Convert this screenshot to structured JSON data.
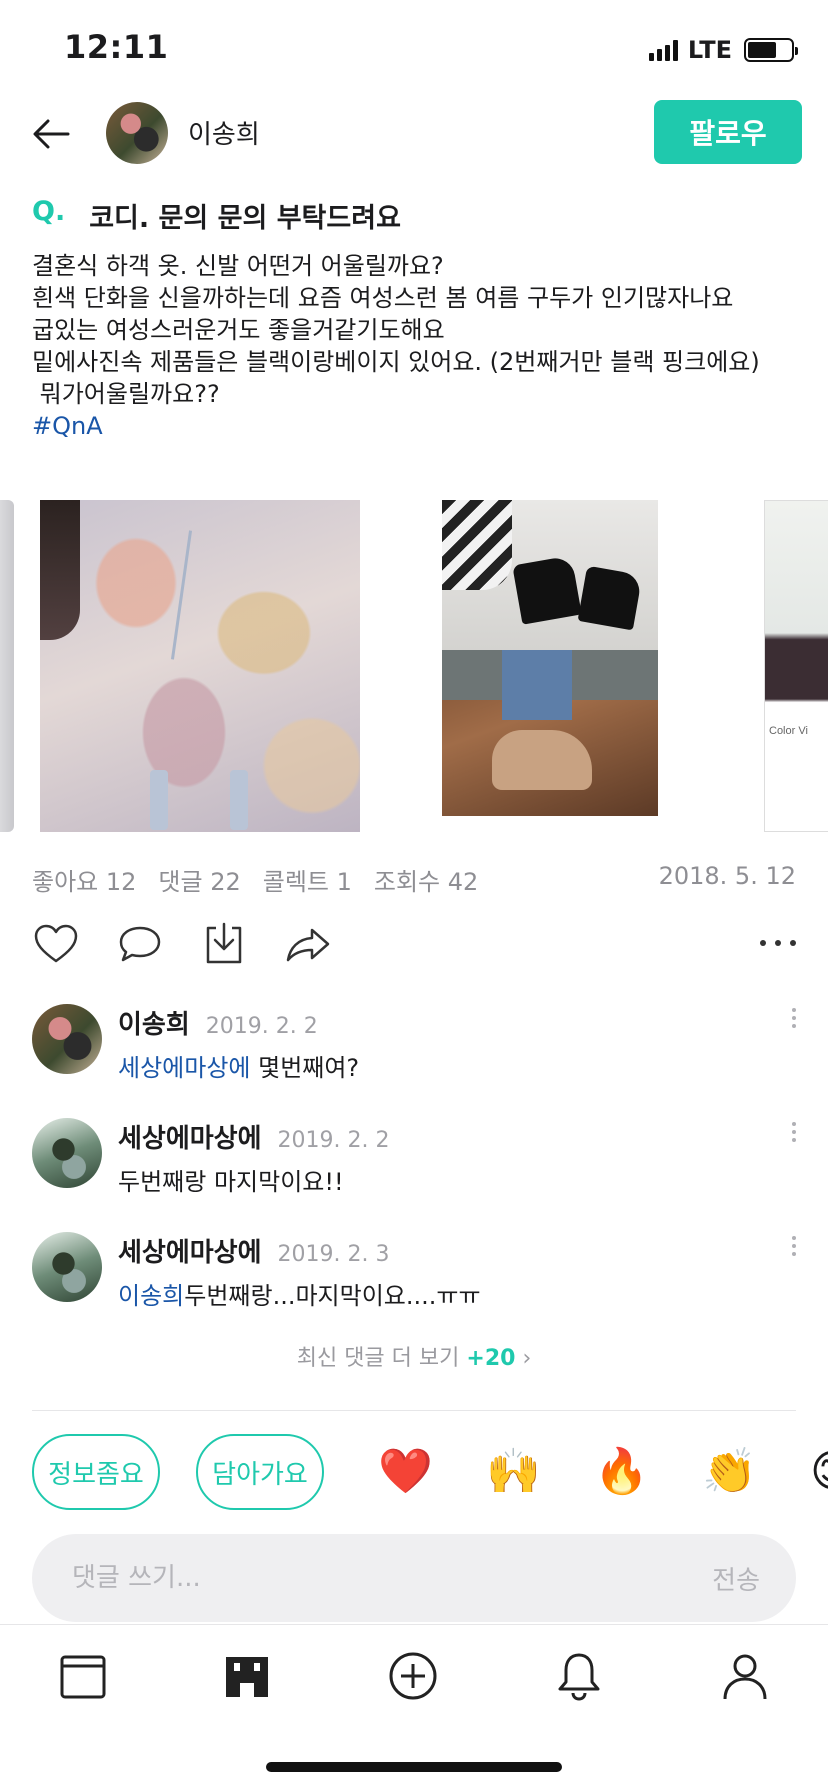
{
  "status_bar": {
    "time": "12:11",
    "network": "LTE"
  },
  "header": {
    "author": "이송희",
    "follow_label": "팔로우"
  },
  "post": {
    "q_mark": "Q.",
    "title": "코디. 문의 문의 부탁드려요",
    "body_lines": [
      "결혼식 하객 옷. 신발 어떤거 어울릴까요?",
      "흰색 단화을 신을까하는데 요즘 여성스런 봄 여름 구두가 인기많자나요",
      "굽있는 여성스러운거도 좋을거같기도해요",
      "밑에사진속 제품들은 블랙이랑베이지 있어요. (2번째거만 블랙 핑크에요)",
      " 뭐가어울릴까요??"
    ],
    "hashtag": "#QnA",
    "image_caption": "Color Vi"
  },
  "stats": {
    "likes": "좋아요 12",
    "comments": "댓글 22",
    "collects": "콜렉트 1",
    "views": "조회수 42",
    "date": "2018. 5. 12"
  },
  "comments": [
    {
      "author": "이송희",
      "date": "2019. 2. 2",
      "mention": "세상에마상에",
      "text": " 몇번째여?"
    },
    {
      "author": "세상에마상에",
      "date": "2019. 2. 2",
      "mention": "",
      "text": "두번째랑 마지막이요!!"
    },
    {
      "author": "세상에마상에",
      "date": "2019. 2. 3",
      "mention": "이송희",
      "text": "두번째랑...마지막이요....ㅠㅠ"
    }
  ],
  "more_comments": {
    "label": "최신 댓글 더 보기",
    "count": "+20",
    "chevron": "›"
  },
  "reactions": {
    "pills": [
      "정보좀요",
      "담아가요"
    ],
    "emojis": [
      "❤️",
      "🙌",
      "🔥",
      "👏",
      "😊"
    ]
  },
  "comment_input": {
    "placeholder": "댓글 쓰기...",
    "send_label": "전송"
  },
  "colors": {
    "accent": "#1fc9ad",
    "link": "#1a56a8",
    "muted": "#8e8e93"
  },
  "icons": {
    "actions": [
      "heart-icon",
      "comment-icon",
      "download-icon",
      "share-icon",
      "more-icon"
    ],
    "tabs": [
      "feed-icon",
      "store-icon",
      "add-icon",
      "bell-icon",
      "profile-icon"
    ]
  }
}
